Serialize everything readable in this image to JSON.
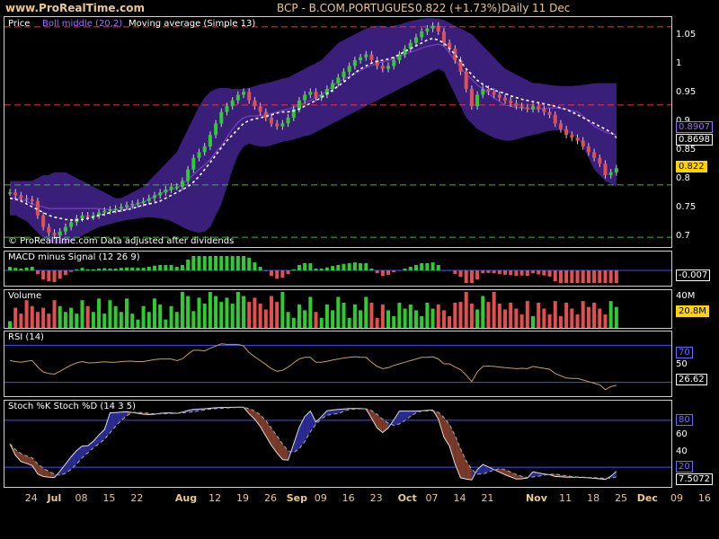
{
  "header": {
    "site": "www.ProRealTime.com",
    "symbol": "BCP - B.COM.PORTUGUES",
    "quote": "0.822 (+1.73%)",
    "period": "Daily",
    "date": "11 Dec"
  },
  "chart_data": [
    {
      "type": "candlestick",
      "title": "Price",
      "legend": [
        "Boll middle (20,2)",
        "Moving average (Simple 13)"
      ],
      "note": "© ProRealTime.com Data adjusted after dividends",
      "y_ticks": [
        "1.05",
        "1",
        "0.95",
        "0.9",
        "0.85",
        "0.8",
        "0.75",
        "0.7"
      ],
      "ylim": [
        0.685,
        1.085
      ],
      "boxes": [
        "0.8907",
        "0.8698",
        "0.822"
      ],
      "close": [
        0.78,
        0.775,
        0.77,
        0.768,
        0.765,
        0.74,
        0.72,
        0.71,
        0.705,
        0.712,
        0.72,
        0.728,
        0.735,
        0.74,
        0.738,
        0.74,
        0.745,
        0.748,
        0.75,
        0.752,
        0.755,
        0.758,
        0.76,
        0.762,
        0.765,
        0.77,
        0.775,
        0.78,
        0.785,
        0.79,
        0.79,
        0.8,
        0.82,
        0.84,
        0.85,
        0.86,
        0.88,
        0.9,
        0.92,
        0.93,
        0.94,
        0.95,
        0.955,
        0.94,
        0.93,
        0.92,
        0.91,
        0.9,
        0.895,
        0.9,
        0.91,
        0.925,
        0.94,
        0.95,
        0.955,
        0.945,
        0.95,
        0.96,
        0.97,
        0.98,
        0.99,
        1.0,
        1.01,
        1.015,
        1.02,
        1.01,
        1.0,
        0.995,
        1.0,
        1.01,
        1.02,
        1.03,
        1.04,
        1.05,
        1.06,
        1.065,
        1.07,
        1.06,
        1.04,
        1.03,
        1.01,
        0.99,
        0.96,
        0.93,
        0.95,
        0.96,
        0.955,
        0.95,
        0.945,
        0.94,
        0.935,
        0.93,
        0.928,
        0.925,
        0.93,
        0.925,
        0.92,
        0.915,
        0.9,
        0.89,
        0.88,
        0.875,
        0.87,
        0.86,
        0.85,
        0.84,
        0.83,
        0.81,
        0.815,
        0.822
      ],
      "boll_upper": [
        0.8,
        0.8,
        0.8,
        0.8,
        0.8,
        0.805,
        0.81,
        0.81,
        0.815,
        0.815,
        0.815,
        0.81,
        0.805,
        0.8,
        0.795,
        0.79,
        0.785,
        0.78,
        0.775,
        0.77,
        0.77,
        0.775,
        0.78,
        0.785,
        0.79,
        0.8,
        0.81,
        0.82,
        0.83,
        0.84,
        0.85,
        0.87,
        0.89,
        0.91,
        0.93,
        0.945,
        0.955,
        0.96,
        0.962,
        0.962,
        0.96,
        0.96,
        0.96,
        0.962,
        0.965,
        0.968,
        0.97,
        0.972,
        0.975,
        0.978,
        0.98,
        0.985,
        0.99,
        0.995,
        1.0,
        1.005,
        1.01,
        1.02,
        1.03,
        1.04,
        1.045,
        1.05,
        1.055,
        1.06,
        1.065,
        1.068,
        1.07,
        1.07,
        1.068,
        1.07,
        1.072,
        1.075,
        1.078,
        1.08,
        1.082,
        1.083,
        1.083,
        1.082,
        1.08,
        1.075,
        1.07,
        1.065,
        1.06,
        1.055,
        1.045,
        1.035,
        1.025,
        1.015,
        1.005,
        0.995,
        0.99,
        0.985,
        0.98,
        0.975,
        0.97,
        0.97,
        0.968,
        0.967,
        0.966,
        0.965,
        0.965,
        0.965,
        0.966,
        0.967,
        0.968,
        0.97,
        0.97,
        0.97,
        0.97,
        0.97
      ],
      "boll_lower": [
        0.74,
        0.74,
        0.735,
        0.73,
        0.72,
        0.71,
        0.7,
        0.695,
        0.69,
        0.69,
        0.69,
        0.695,
        0.7,
        0.705,
        0.71,
        0.715,
        0.72,
        0.722,
        0.725,
        0.728,
        0.73,
        0.732,
        0.733,
        0.735,
        0.736,
        0.737,
        0.736,
        0.735,
        0.733,
        0.73,
        0.725,
        0.72,
        0.715,
        0.712,
        0.71,
        0.712,
        0.72,
        0.74,
        0.76,
        0.79,
        0.82,
        0.845,
        0.86,
        0.865,
        0.862,
        0.86,
        0.86,
        0.862,
        0.865,
        0.868,
        0.87,
        0.872,
        0.875,
        0.878,
        0.88,
        0.885,
        0.89,
        0.895,
        0.9,
        0.905,
        0.91,
        0.915,
        0.92,
        0.925,
        0.93,
        0.935,
        0.94,
        0.945,
        0.95,
        0.955,
        0.96,
        0.965,
        0.97,
        0.975,
        0.98,
        0.985,
        0.99,
        0.995,
        0.99,
        0.97,
        0.95,
        0.93,
        0.91,
        0.9,
        0.89,
        0.885,
        0.88,
        0.875,
        0.872,
        0.87,
        0.87,
        0.872,
        0.875,
        0.878,
        0.88,
        0.882,
        0.885,
        0.887,
        0.888,
        0.888,
        0.885,
        0.88,
        0.875,
        0.86,
        0.84,
        0.82,
        0.81,
        0.8,
        0.795,
        0.79
      ],
      "boll_middle": [
        0.77,
        0.77,
        0.768,
        0.765,
        0.76,
        0.757,
        0.755,
        0.752,
        0.752,
        0.752,
        0.752,
        0.752,
        0.752,
        0.752,
        0.752,
        0.752,
        0.752,
        0.751,
        0.75,
        0.749,
        0.75,
        0.753,
        0.756,
        0.76,
        0.763,
        0.768,
        0.773,
        0.778,
        0.782,
        0.785,
        0.787,
        0.795,
        0.802,
        0.811,
        0.82,
        0.828,
        0.837,
        0.85,
        0.861,
        0.876,
        0.89,
        0.902,
        0.91,
        0.913,
        0.913,
        0.914,
        0.915,
        0.917,
        0.92,
        0.923,
        0.925,
        0.928,
        0.932,
        0.936,
        0.94,
        0.945,
        0.95,
        0.957,
        0.965,
        0.972,
        0.977,
        0.982,
        0.987,
        0.992,
        0.997,
        1.001,
        1.005,
        1.007,
        1.009,
        1.012,
        1.016,
        1.02,
        1.024,
        1.027,
        1.031,
        1.034,
        1.036,
        1.038,
        1.035,
        1.022,
        1.01,
        0.997,
        0.985,
        0.977,
        0.967,
        0.96,
        0.952,
        0.945,
        0.938,
        0.932,
        0.93,
        0.928,
        0.927,
        0.926,
        0.925,
        0.926,
        0.926,
        0.927,
        0.927,
        0.926,
        0.925,
        0.922,
        0.92,
        0.913,
        0.904,
        0.895,
        0.89,
        0.885,
        0.882,
        0.88
      ],
      "sma13": [
        0.77,
        0.768,
        0.765,
        0.76,
        0.755,
        0.75,
        0.745,
        0.74,
        0.737,
        0.735,
        0.733,
        0.732,
        0.732,
        0.733,
        0.735,
        0.737,
        0.74,
        0.742,
        0.745,
        0.747,
        0.748,
        0.75,
        0.752,
        0.755,
        0.758,
        0.76,
        0.762,
        0.765,
        0.77,
        0.775,
        0.78,
        0.785,
        0.79,
        0.798,
        0.808,
        0.82,
        0.832,
        0.845,
        0.858,
        0.87,
        0.88,
        0.89,
        0.9,
        0.905,
        0.908,
        0.91,
        0.912,
        0.915,
        0.918,
        0.92,
        0.92,
        0.922,
        0.925,
        0.93,
        0.935,
        0.94,
        0.945,
        0.952,
        0.958,
        0.965,
        0.972,
        0.98,
        0.988,
        0.995,
        1.0,
        1.005,
        1.008,
        1.01,
        1.012,
        1.015,
        1.02,
        1.025,
        1.03,
        1.035,
        1.04,
        1.045,
        1.048,
        1.045,
        1.04,
        1.03,
        1.02,
        1.008,
        0.995,
        0.985,
        0.975,
        0.968,
        0.962,
        0.958,
        0.955,
        0.952,
        0.948,
        0.945,
        0.942,
        0.94,
        0.938,
        0.936,
        0.934,
        0.932,
        0.93,
        0.927,
        0.924,
        0.92,
        0.915,
        0.91,
        0.905,
        0.9,
        0.895,
        0.89,
        0.885,
        0.875
      ],
      "hlines": [
        {
          "value": 1.068,
          "color": "#ff3030"
        },
        {
          "value": 0.932,
          "color": "#ff3030"
        },
        {
          "value": 0.793,
          "color": "#30c030"
        },
        {
          "value": 0.702,
          "color": "#30c030"
        }
      ]
    },
    {
      "type": "bar",
      "title": "MACD minus Signal (12 26 9)",
      "ylim": [
        -0.013,
        0.01
      ],
      "box": "-0.007"
    },
    {
      "type": "bar",
      "title": "Volume",
      "y_ticks": [
        "40M"
      ],
      "box": "20.8M",
      "ylim": [
        0,
        45
      ]
    },
    {
      "type": "line",
      "title": "RSI (14)",
      "y_ticks": [
        "70",
        "50"
      ],
      "boxes": [
        "26.62"
      ],
      "ylim": [
        15,
        85
      ],
      "hlines": [
        70,
        30
      ]
    },
    {
      "type": "line",
      "title": "Stoch %K Stoch %D (14 3 5)",
      "y_ticks": [
        "80",
        "60",
        "40",
        "20"
      ],
      "boxes": [
        "80",
        "20",
        "7.5072"
      ],
      "ylim": [
        -5,
        105
      ],
      "hlines": [
        80,
        20
      ]
    }
  ],
  "x_axis": {
    "ticks": [
      {
        "label": "24",
        "bold": false,
        "i": 4
      },
      {
        "label": "Jul",
        "bold": true,
        "i": 8
      },
      {
        "label": "08",
        "bold": false,
        "i": 13
      },
      {
        "label": "15",
        "bold": false,
        "i": 18
      },
      {
        "label": "22",
        "bold": false,
        "i": 23
      },
      {
        "label": "Aug",
        "bold": true,
        "i": 31
      },
      {
        "label": "12",
        "bold": false,
        "i": 37
      },
      {
        "label": "19",
        "bold": false,
        "i": 42
      },
      {
        "label": "26",
        "bold": false,
        "i": 47
      },
      {
        "label": "Sep",
        "bold": true,
        "i": 51
      },
      {
        "label": "09",
        "bold": false,
        "i": 56
      },
      {
        "label": "16",
        "bold": false,
        "i": 61
      },
      {
        "label": "23",
        "bold": false,
        "i": 66
      },
      {
        "label": "Oct",
        "bold": true,
        "i": 71
      },
      {
        "label": "07",
        "bold": false,
        "i": 76
      },
      {
        "label": "14",
        "bold": false,
        "i": 81
      },
      {
        "label": "21",
        "bold": false,
        "i": 86
      },
      {
        "label": "Nov",
        "bold": true,
        "i": 94
      },
      {
        "label": "11",
        "bold": false,
        "i": 100
      },
      {
        "label": "18",
        "bold": false,
        "i": 105
      },
      {
        "label": "25",
        "bold": false,
        "i": 110
      },
      {
        "label": "Dec",
        "bold": true,
        "i": 114
      },
      {
        "label": "09",
        "bold": false,
        "i": 120
      },
      {
        "label": "16",
        "bold": false,
        "i": 125
      }
    ]
  },
  "colors": {
    "band": "#3a1f7a",
    "up": "#2ecc2e",
    "down": "#e05050",
    "header_text": "#e8c98a"
  }
}
